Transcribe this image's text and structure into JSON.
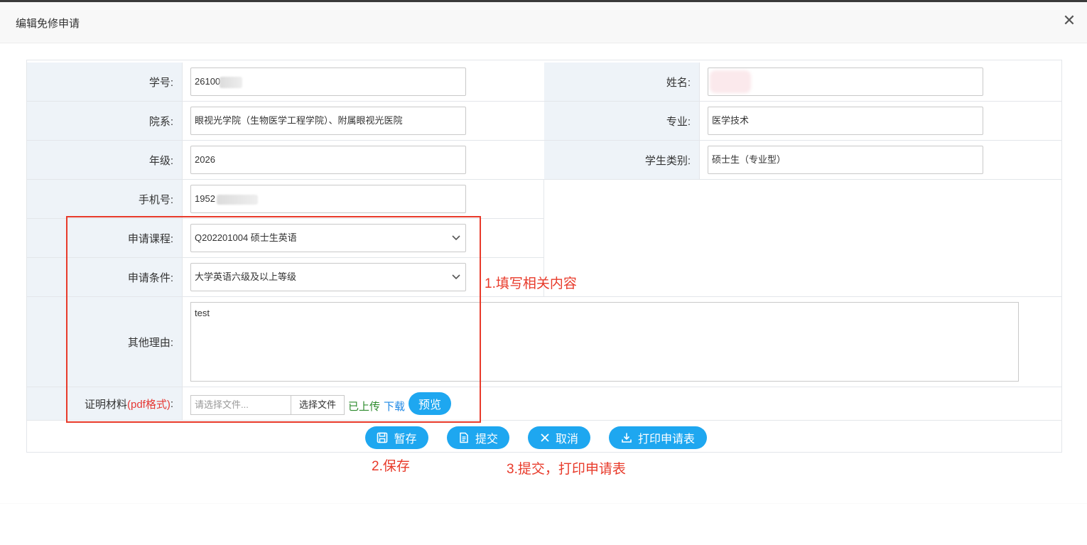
{
  "modal": {
    "title": "编辑免修申请",
    "close_label": "✕"
  },
  "fields": {
    "student_id": {
      "label": "学号:",
      "value": "261003"
    },
    "name": {
      "label": "姓名:",
      "value": ""
    },
    "department": {
      "label": "院系:",
      "value": "眼视光学院（生物医学工程学院）、附属眼视光医院"
    },
    "major": {
      "label": "专业:",
      "value": "医学技术"
    },
    "grade": {
      "label": "年级:",
      "value": "2026"
    },
    "student_type": {
      "label": "学生类别:",
      "value": "硕士生（专业型）"
    },
    "phone": {
      "label": "手机号:",
      "value": "1952"
    },
    "course": {
      "label": "申请课程:",
      "value": "Q202201004 硕士生英语"
    },
    "condition": {
      "label": "申请条件:",
      "value": "大学英语六级及以上等级"
    },
    "reason": {
      "label": "其他理由:",
      "value": "test"
    },
    "proof": {
      "label_main": "证明材料",
      "label_suffix": "(pdf格式)",
      "label_colon": ":",
      "placeholder": "请选择文件...",
      "choose_label": "选择文件",
      "uploaded_text": "已上传",
      "download_label": "下载",
      "preview_label": "预览"
    }
  },
  "actions": {
    "save_label": "暂存",
    "submit_label": "提交",
    "cancel_label": "取消",
    "print_label": "打印申请表"
  },
  "annotations": {
    "step1": "1.填写相关内容",
    "step2": "2.保存",
    "step3": "3.提交，打印申请表"
  },
  "icons": {
    "close": "close-icon",
    "select_arrow": "chevron-down-icon",
    "save": "save-icon",
    "submit": "document-icon",
    "cancel": "close-icon",
    "print": "download-icon"
  },
  "colors": {
    "accent": "#1ea7f0",
    "annotation": "#e83a2a",
    "uploaded": "#2e8b2e",
    "link": "#1e88e5",
    "label_bg": "#eef3f8"
  }
}
